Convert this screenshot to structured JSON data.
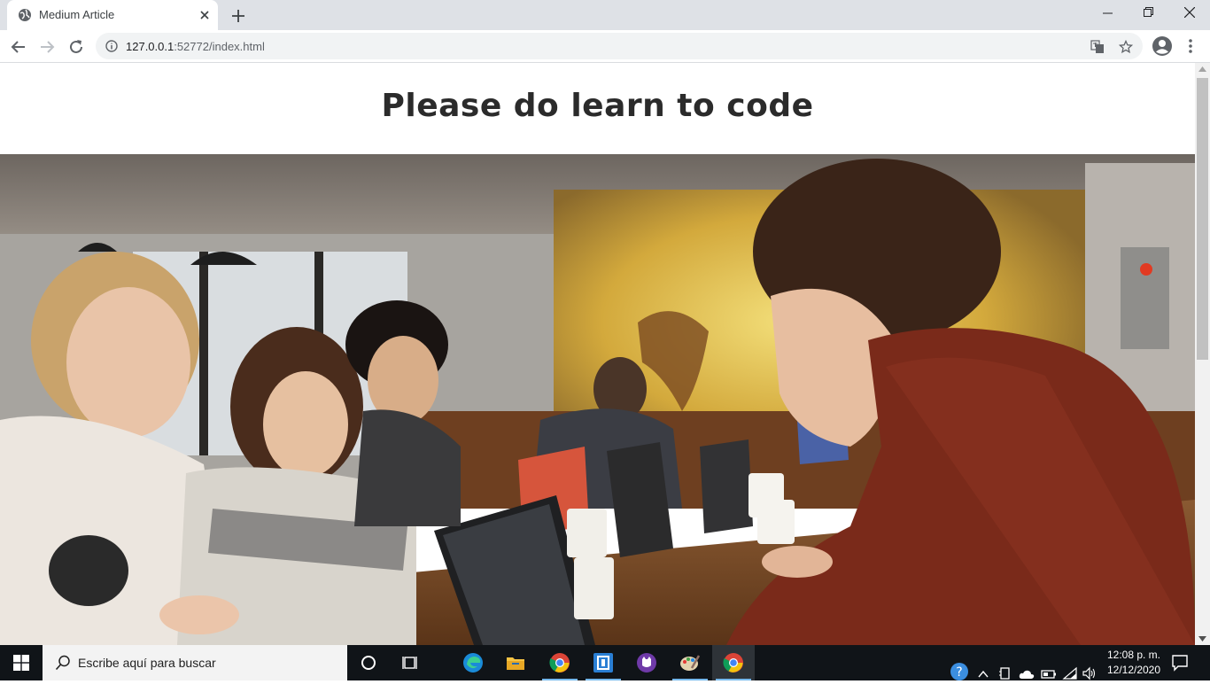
{
  "browser": {
    "tab_title": "Medium Article",
    "url_host": "127.0.0.1",
    "url_path": ":52772/index.html"
  },
  "page": {
    "title": "Please do learn to code",
    "hero_image": "photo-students-coding-in-cafe"
  },
  "taskbar": {
    "search_placeholder": "Escribe aquí para buscar",
    "time": "12:08 p. m.",
    "date": "12/12/2020",
    "apps": [
      "cortana-icon",
      "task-view-icon",
      "edge-icon",
      "file-explorer-icon",
      "chrome-icon",
      "app-blue-icon",
      "app-purple-icon",
      "paint-icon",
      "chrome-icon"
    ]
  },
  "colors": {
    "tab_bar": "#dee1e6",
    "omnibox": "#f1f3f4",
    "taskbar": "#101418",
    "title_text": "#2b2b2b"
  }
}
